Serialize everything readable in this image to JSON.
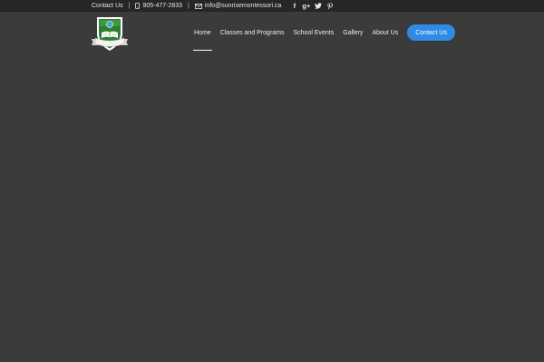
{
  "topbar": {
    "contact_label": "Contact Us",
    "separator": "|",
    "phone": "905-477-2833",
    "email": "info@sunrisemontessori.ca",
    "social": [
      {
        "icon": "facebook-icon",
        "glyph": "f"
      },
      {
        "icon": "google-plus-icon",
        "glyph": "g+"
      },
      {
        "icon": "twitter-icon",
        "glyph": "t"
      },
      {
        "icon": "pinterest-icon",
        "glyph": "p"
      }
    ]
  },
  "logo": {
    "ribbon_text": "Education for Life",
    "colors": {
      "shield": "#2e7d32",
      "border": "#ffffff",
      "ribbon": "#f2f2f2"
    }
  },
  "nav": {
    "items": [
      {
        "label": "Home",
        "active": true
      },
      {
        "label": "Classes and Programs",
        "active": false
      },
      {
        "label": "School Events",
        "active": false
      },
      {
        "label": "Gallery",
        "active": false
      },
      {
        "label": "About Us",
        "active": false
      }
    ],
    "cta_label": "Contact Us"
  },
  "colors": {
    "page_bg": "#3b3b3b",
    "topbar_bg": "#262626",
    "accent": "#2f8be6"
  }
}
